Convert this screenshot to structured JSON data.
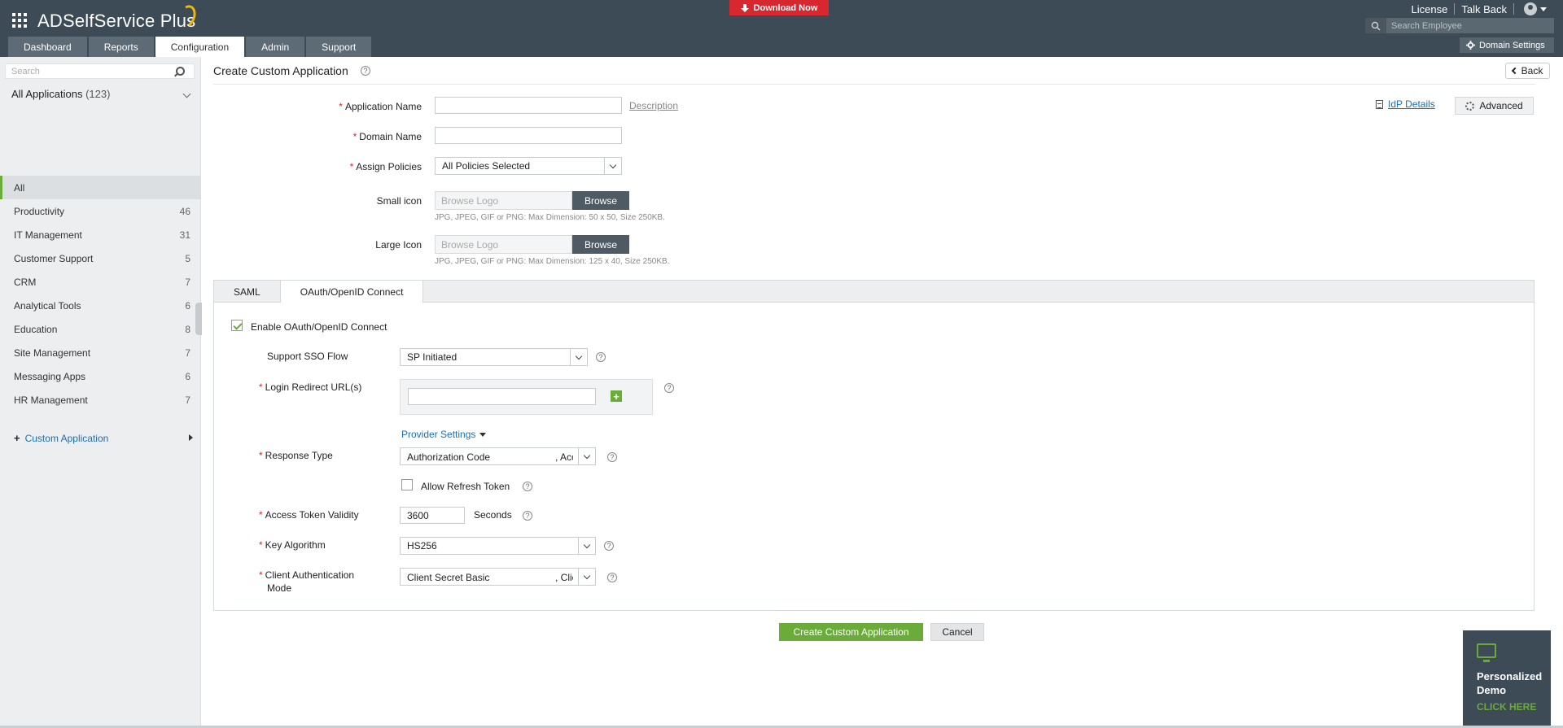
{
  "header": {
    "app_name": "ADSelfService Plus",
    "download_label": "Download Now",
    "license_label": "License",
    "talkback_label": "Talk Back",
    "search_placeholder": "Search Employee",
    "domain_settings_label": "Domain Settings",
    "tabs": [
      {
        "label": "Dashboard",
        "active": false
      },
      {
        "label": "Reports",
        "active": false
      },
      {
        "label": "Configuration",
        "active": true
      },
      {
        "label": "Admin",
        "active": false
      },
      {
        "label": "Support",
        "active": false
      }
    ],
    "accent_color": "#d7282f"
  },
  "sidebar": {
    "search_placeholder": "Search",
    "all_apps_label": "All Applications",
    "all_apps_count": "(123)",
    "items": [
      {
        "label": "All",
        "count": ""
      },
      {
        "label": "Productivity",
        "count": "46"
      },
      {
        "label": "IT Management",
        "count": "31"
      },
      {
        "label": "Customer Support",
        "count": "5"
      },
      {
        "label": "CRM",
        "count": "7"
      },
      {
        "label": "Analytical Tools",
        "count": "6"
      },
      {
        "label": "Education",
        "count": "8"
      },
      {
        "label": "Site Management",
        "count": "7"
      },
      {
        "label": "Messaging Apps",
        "count": "6"
      },
      {
        "label": "HR Management",
        "count": "7"
      }
    ],
    "custom_app_label": "Custom Application"
  },
  "page": {
    "title": "Create Custom Application",
    "back_label": "Back",
    "idp_details_label": "IdP Details",
    "advanced_label": "Advanced"
  },
  "form": {
    "app_name_label": "Application Name",
    "app_name_value": "",
    "description_label": "Description",
    "domain_name_label": "Domain Name",
    "domain_name_value": "",
    "assign_policies_label": "Assign Policies",
    "assign_policies_value": "All Policies Selected",
    "small_icon_label": "Small icon",
    "large_icon_label": "Large Icon",
    "browse_placeholder": "Browse Logo",
    "browse_label": "Browse",
    "small_icon_hint": "JPG, JPEG, GIF or PNG: Max Dimension: 50 x 50, Size 250KB.",
    "large_icon_hint": "JPG, JPEG, GIF or PNG: Max Dimension: 125 x 40, Size 250KB."
  },
  "protocol": {
    "tabs": [
      {
        "label": "SAML",
        "active": false
      },
      {
        "label": "OAuth/OpenID Connect",
        "active": true
      }
    ],
    "enable_label": "Enable OAuth/OpenID Connect",
    "enable_checked": true,
    "sso_flow_label": "Support SSO Flow",
    "sso_flow_value": "SP Initiated",
    "redirect_label": "Login Redirect URL(s)",
    "redirect_value": "",
    "provider_settings_label": "Provider Settings",
    "response_type_label": "Response Type",
    "response_type_value": "Authorization Code",
    "response_type_value2": ", Acc",
    "allow_refresh_label": "Allow Refresh Token",
    "allow_refresh_checked": false,
    "token_validity_label": "Access Token Validity",
    "token_validity_value": "3600",
    "token_validity_unit": "Seconds",
    "key_algorithm_label": "Key Algorithm",
    "key_algorithm_value": "HS256",
    "client_auth_label_1": "Client Authentication",
    "client_auth_label_2": "Mode",
    "client_auth_value": "Client Secret Basic",
    "client_auth_value2": ", Clie"
  },
  "actions": {
    "create_label": "Create Custom Application",
    "cancel_label": "Cancel"
  },
  "demo_widget": {
    "title_1": "Personalized",
    "title_2": "Demo",
    "cta": "CLICK HERE"
  }
}
